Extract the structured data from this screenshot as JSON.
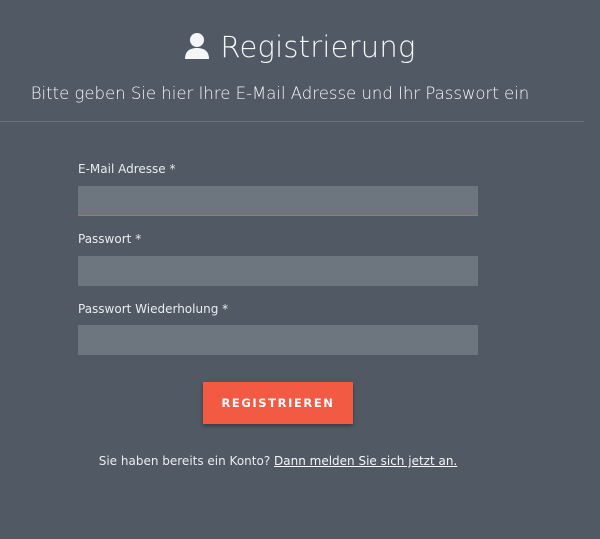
{
  "header": {
    "title": "Registrierung",
    "title_icon": "user-icon",
    "subtitle": "Bitte geben Sie hier Ihre E-Mail Adresse und Ihr Passwort ein"
  },
  "form": {
    "fields": [
      {
        "label": "E-Mail Adresse",
        "required_mark": "*",
        "value": "",
        "placeholder": ""
      },
      {
        "label": "Passwort",
        "required_mark": "*",
        "value": "",
        "placeholder": ""
      },
      {
        "label": "Passwort Wiederholung",
        "required_mark": "*",
        "value": "",
        "placeholder": ""
      }
    ],
    "submit_label": "REGISTRIEREN"
  },
  "footer": {
    "prompt": "Sie haben bereits ein Konto?",
    "link_label": "Dann melden Sie sich jetzt an."
  },
  "colors": {
    "background": "#515a64",
    "input_background": "#6d767f",
    "accent": "#f25a43",
    "error_underline": "#e05a4f"
  }
}
